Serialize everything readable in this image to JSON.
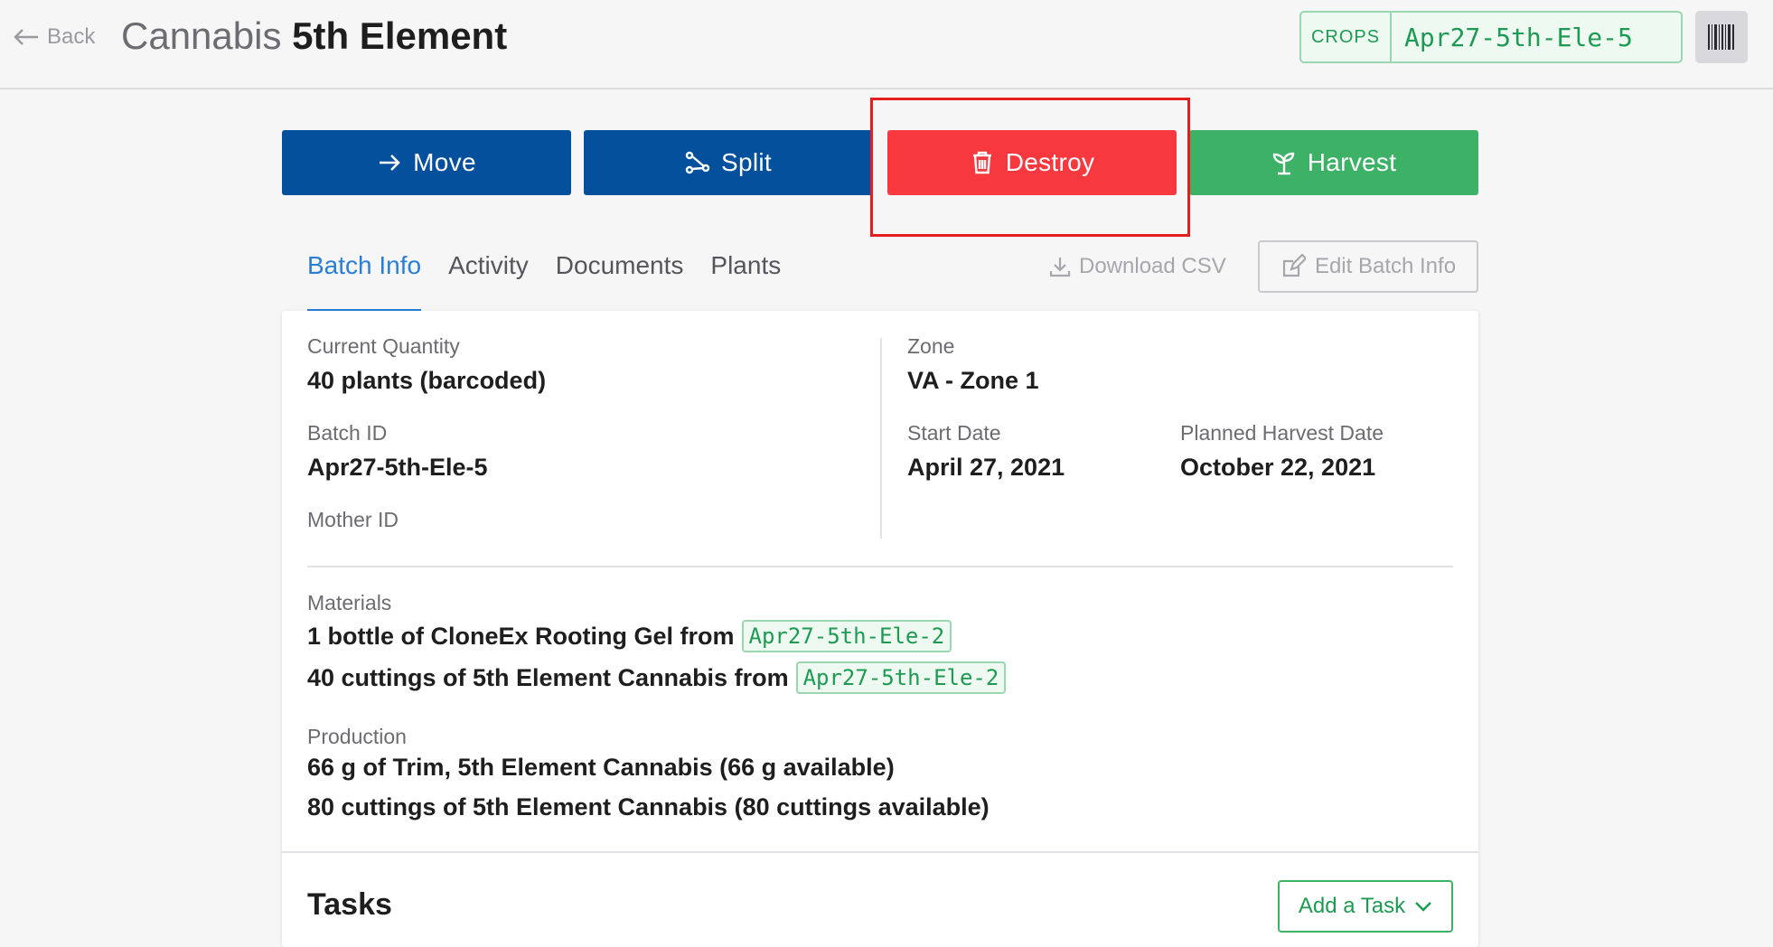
{
  "header": {
    "back_label": "Back",
    "title_prefix": "Cannabis",
    "title_name": "5th Element",
    "crops_label": "CROPS",
    "batch_id": "Apr27-5th-Ele-5"
  },
  "actions": {
    "move": "Move",
    "split": "Split",
    "destroy": "Destroy",
    "harvest": "Harvest"
  },
  "tabs": [
    {
      "label": "Batch Info",
      "active": true
    },
    {
      "label": "Activity",
      "active": false
    },
    {
      "label": "Documents",
      "active": false
    },
    {
      "label": "Plants",
      "active": false
    }
  ],
  "toolbar": {
    "download_csv": "Download CSV",
    "edit_batch_info": "Edit Batch Info"
  },
  "batch_info": {
    "current_quantity_label": "Current Quantity",
    "current_quantity": "40 plants (barcoded)",
    "batch_id_label": "Batch ID",
    "batch_id": "Apr27-5th-Ele-5",
    "mother_id_label": "Mother ID",
    "zone_label": "Zone",
    "zone": "VA - Zone 1",
    "start_date_label": "Start Date",
    "start_date": "April 27, 2021",
    "planned_harvest_label": "Planned Harvest Date",
    "planned_harvest": "October 22, 2021"
  },
  "materials": {
    "label": "Materials",
    "items": [
      {
        "text": "1 bottle of CloneEx Rooting Gel from",
        "source": "Apr27-5th-Ele-2"
      },
      {
        "text": "40 cuttings of 5th Element Cannabis from",
        "source": "Apr27-5th-Ele-2"
      }
    ]
  },
  "production": {
    "label": "Production",
    "items": [
      "66 g of Trim, 5th Element Cannabis (66 g available)",
      "80 cuttings of 5th Element Cannabis (80 cuttings available)"
    ]
  },
  "tasks": {
    "title": "Tasks",
    "add_task": "Add a Task"
  },
  "colors": {
    "primary_blue": "#04509c",
    "destroy_red": "#f7393f",
    "harvest_green": "#3db267",
    "tab_active": "#2a7fd4"
  }
}
